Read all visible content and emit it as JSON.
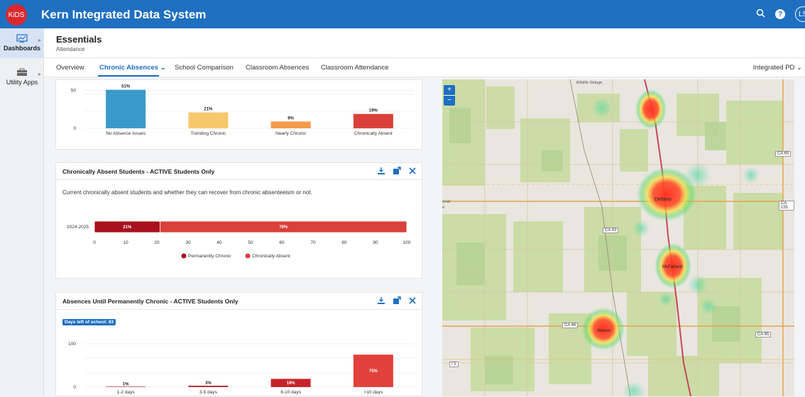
{
  "app": {
    "logo_text": "KiDS",
    "title": "Kern Integrated Data System",
    "avatar_initials": "LS"
  },
  "sidebar": {
    "items": [
      {
        "label": "Dashboards",
        "icon": "dashboard-icon"
      },
      {
        "label": "Utility Apps",
        "icon": "toolbox-icon"
      }
    ]
  },
  "header": {
    "title": "Essentials",
    "subtitle": "Attendance"
  },
  "tabs": {
    "items": [
      "Overview",
      "Chronic Absences",
      "School Comparison",
      "Classroom Absences",
      "Classroom Attendance"
    ],
    "active": "Chronic Absences",
    "right_label": "Integrated PD"
  },
  "panel1": {
    "chart_data": {
      "type": "bar",
      "categories": [
        "No Absence Issues",
        "Trending Chronic",
        "Nearly Chronic",
        "Chronically Absent"
      ],
      "values": [
        51,
        21,
        9,
        19
      ],
      "data_labels": [
        "51%",
        "21%",
        "9%",
        "19%"
      ],
      "colors": [
        "#3a9ac9",
        "#f7c76b",
        "#f49b4c",
        "#d9403a"
      ],
      "yticks": [
        "0",
        "50"
      ],
      "ylim": [
        0,
        60
      ]
    }
  },
  "panel2": {
    "title": "Chronically Absent Students - ACTIVE Students Only",
    "description": "Current chronically absent students and whether they can recover from chronic absenteeism or not.",
    "chart_data": {
      "type": "bar",
      "orientation": "horizontal-stacked",
      "categories": [
        "2024-2025"
      ],
      "series": [
        {
          "name": "Permanently Chronic",
          "values": [
            21
          ],
          "color": "#a8111b",
          "label": "21%"
        },
        {
          "name": "Chronically Absent",
          "values": [
            79
          ],
          "color": "#d9403a",
          "label": "79%"
        }
      ],
      "xticks": [
        "0",
        "10",
        "20",
        "30",
        "40",
        "50",
        "60",
        "70",
        "80",
        "90",
        "100"
      ],
      "xlim": [
        0,
        100
      ],
      "legend": "bottom"
    }
  },
  "panel3": {
    "title": "Absences Until Permanently Chronic - ACTIVE Students Only",
    "badge": "Days left of school: 83",
    "chart_data": {
      "type": "bar",
      "categories": [
        "1-2 days",
        "3-5 days",
        "6-10 days",
        ">10 days"
      ],
      "values": [
        1,
        3,
        19,
        75
      ],
      "data_labels": [
        "1%",
        "3%",
        "19%",
        "75%"
      ],
      "colors": [
        "#a8111b",
        "#b71c24",
        "#c7232b",
        "#e2403b"
      ],
      "yticks": [
        "0",
        "100"
      ],
      "ylim": [
        0,
        100
      ]
    }
  },
  "map": {
    "zoom_in": "+",
    "zoom_out": "−",
    "road_labels": [
      "CA 65",
      "CA 155",
      "CA 43",
      "CA 46",
      "CA 65",
      "I 5"
    ],
    "place_labels": [
      "Delano",
      "McFarland",
      "Wasco",
      "Wildlife Refuge",
      "onal",
      "e"
    ]
  }
}
